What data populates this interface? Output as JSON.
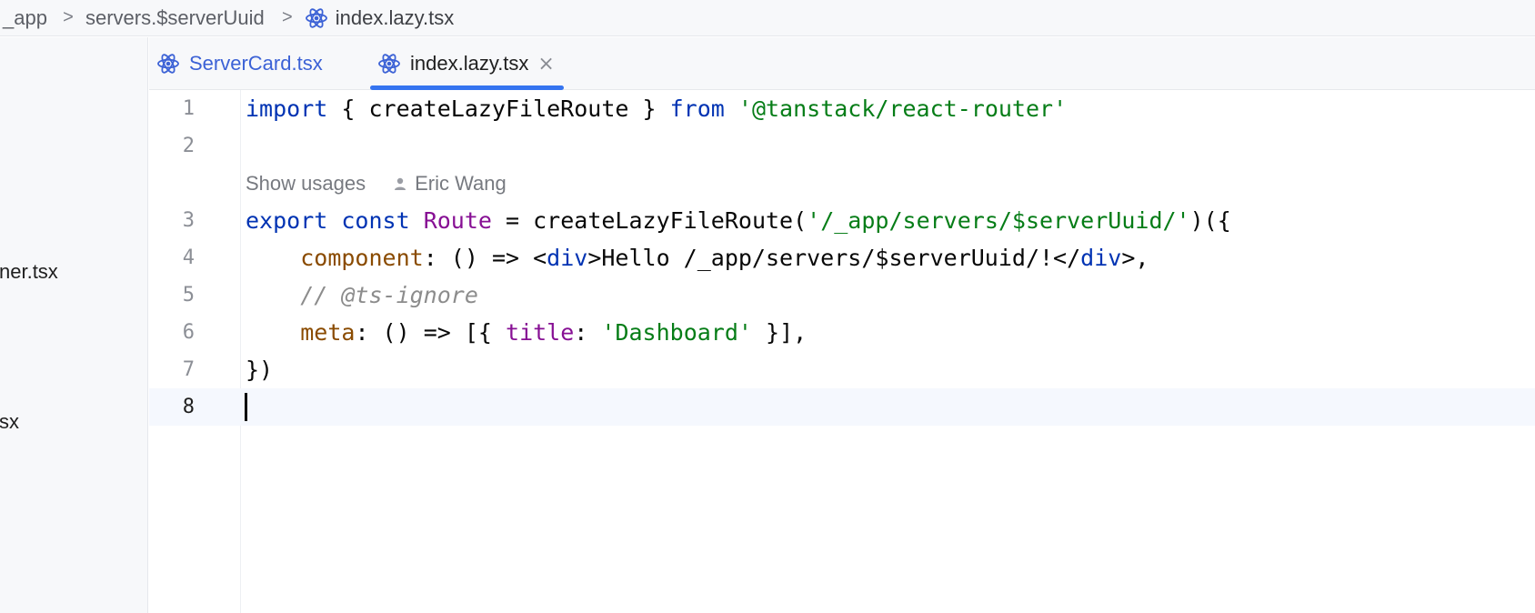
{
  "breadcrumb": {
    "items": [
      "_app",
      "servers.$serverUuid",
      "index.lazy.tsx"
    ],
    "separator": ">"
  },
  "project_tree": {
    "items": [
      "ner.tsx",
      "sx"
    ]
  },
  "tabs": [
    {
      "label": "ServerCard.tsx",
      "active": false,
      "icon": "react-icon"
    },
    {
      "label": "index.lazy.tsx",
      "active": true,
      "icon": "react-icon",
      "close": "×"
    }
  ],
  "editor": {
    "line_numbers": [
      "1",
      "2",
      "3",
      "4",
      "5",
      "6",
      "7",
      "8"
    ],
    "inlay_hint": {
      "usages": "Show usages",
      "author": "Eric Wang"
    },
    "lines": {
      "l1": {
        "kw_import": "import",
        "brace_open": " { ",
        "name": "createLazyFileRoute",
        "brace_close": " } ",
        "kw_from": "from",
        "space": " ",
        "module": "'@tanstack/react-router'"
      },
      "l3": {
        "kw_export": "export",
        "kw_const": "const",
        "route": "Route",
        "eq": " = createLazyFileRoute(",
        "path": "'/_app/servers/$serverUuid/'",
        "end": ")({"
      },
      "l4": {
        "indent": "    ",
        "component": "component",
        "arrow": ": () => <",
        "tag_open": "div",
        "text": ">Hello /_app/servers/$serverUuid/!</",
        "tag_close": "div",
        "end": ">,"
      },
      "l5": {
        "indent": "    ",
        "comment": "// @ts-ignore"
      },
      "l6": {
        "indent": "    ",
        "meta": "meta",
        "arrow": ": () => [{ ",
        "title": "title",
        "colon": ": ",
        "value": "'Dashboard'",
        "end": " }],"
      },
      "l7": {
        "text": "})"
      }
    }
  },
  "colors": {
    "keyword": "#0033b3",
    "string": "#067d17",
    "property": "#871094",
    "object_key": "#8a4b00",
    "comment": "#8c8c8c",
    "accent": "#3574f0",
    "react_icon": "#3c62d6"
  }
}
